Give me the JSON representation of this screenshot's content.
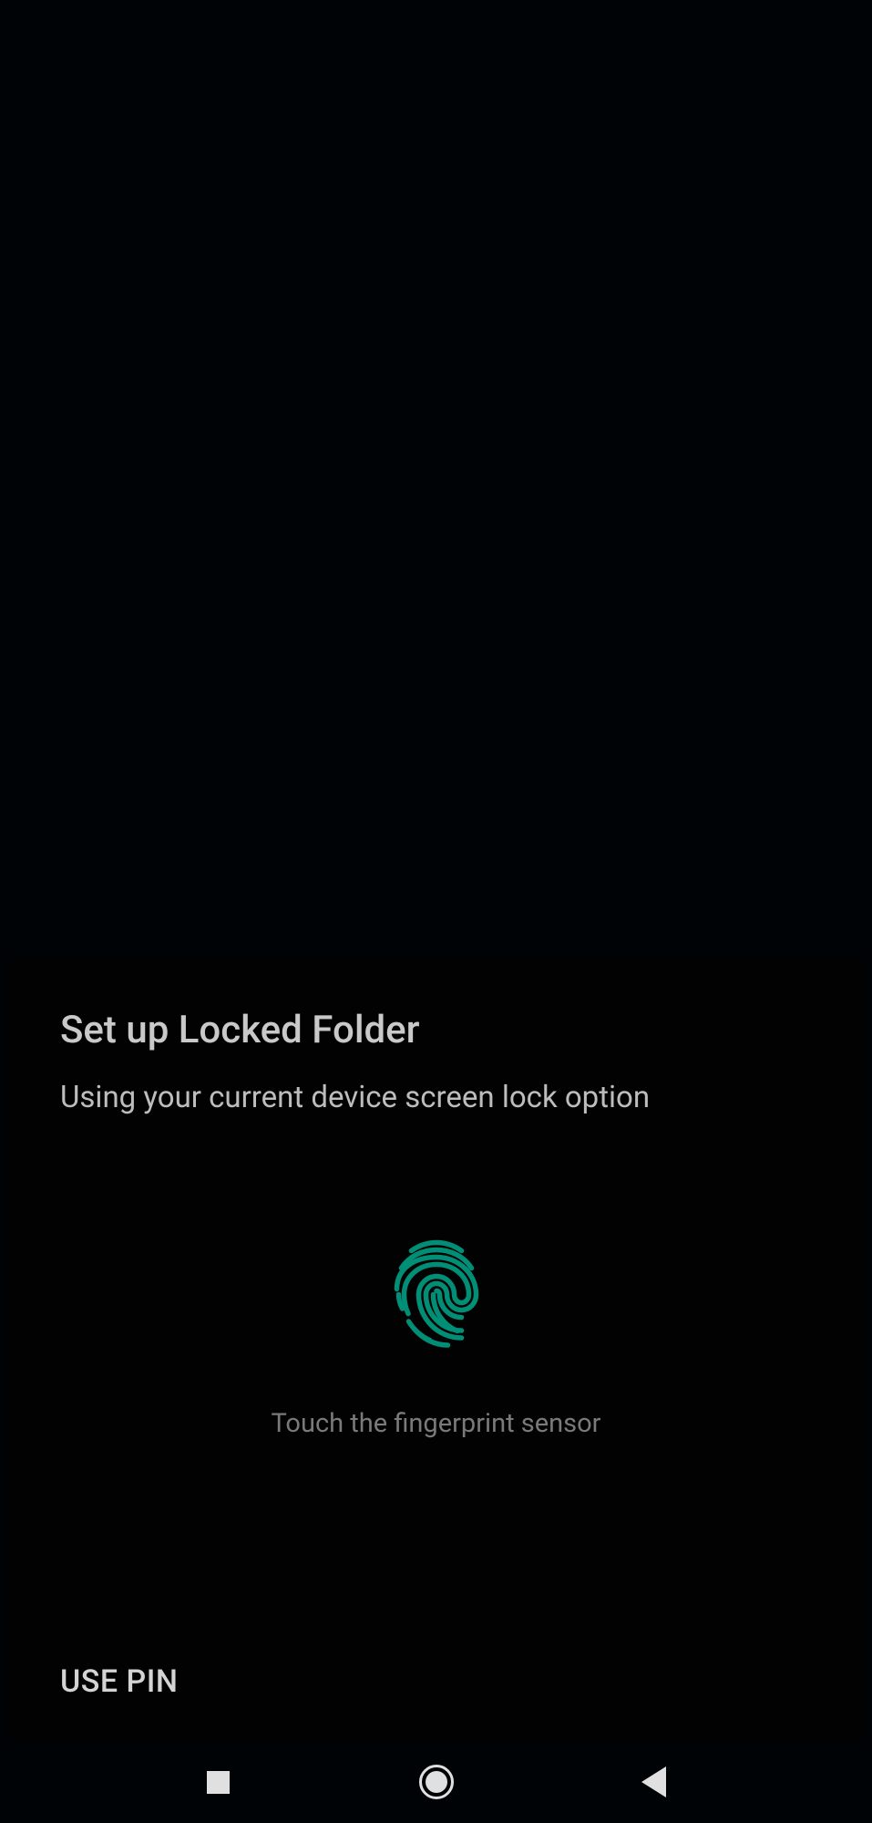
{
  "sheet": {
    "title": "Set up Locked Folder",
    "subtitle": "Using your current device screen lock option",
    "fingerprint_hint": "Touch the fingerprint sensor",
    "use_pin_label": "USE PIN"
  },
  "colors": {
    "accent": "#008e76"
  }
}
